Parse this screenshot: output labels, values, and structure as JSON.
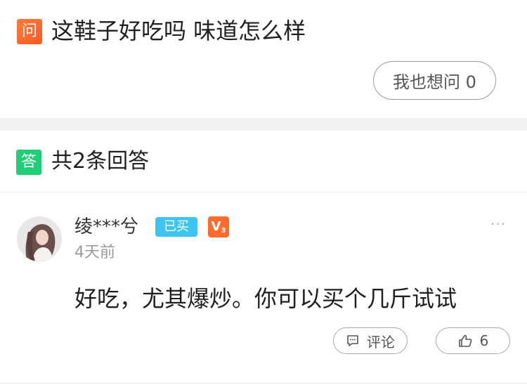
{
  "question": {
    "badge": "问",
    "text": "这鞋子好吃吗 味道怎么样",
    "ask_button_label": "我也想问 0"
  },
  "answers_header": {
    "badge": "答",
    "count_text": "共2条回答"
  },
  "answer": {
    "username": "绫***兮",
    "bought_badge": "已买",
    "vip_level": "V",
    "vip_sub": "3",
    "time": "4天前",
    "more_icon": "···",
    "text": "好吃，尤其爆炒。你可以买个几斤试试",
    "comment_label": "评论",
    "like_count": "6"
  },
  "colors": {
    "question_badge": "#ff6a2a",
    "answer_badge": "#1fce74",
    "bought_badge": "#3ec4f0",
    "vip_badge": "#ff6b2c"
  }
}
